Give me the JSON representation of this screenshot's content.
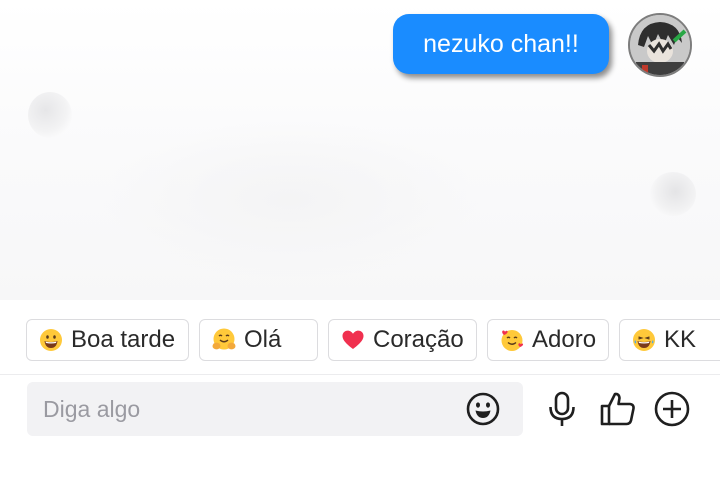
{
  "chat": {
    "messages": [
      {
        "sender": "me",
        "text": "nezuko chan!!"
      }
    ]
  },
  "quick_replies": [
    {
      "label": "Boa tarde",
      "icon": "grinning-face-emoji-icon"
    },
    {
      "label": "Olá",
      "icon": "hugging-face-emoji-icon"
    },
    {
      "label": "Coração",
      "icon": "heart-emoji-icon"
    },
    {
      "label": "Adoro",
      "icon": "smiling-face-with-hearts-emoji-icon"
    },
    {
      "label": "KK",
      "icon": "laughing-face-emoji-icon"
    }
  ],
  "composer": {
    "placeholder": "Diga algo",
    "buttons": [
      "emoji-icon",
      "microphone-icon",
      "thumbs-up-icon",
      "plus-icon"
    ]
  },
  "colors": {
    "bubble": "#1a8cff",
    "emoji_yellow": "#ffc93a",
    "heart": "#f0304f",
    "icon_dark": "#1f1f1f"
  }
}
